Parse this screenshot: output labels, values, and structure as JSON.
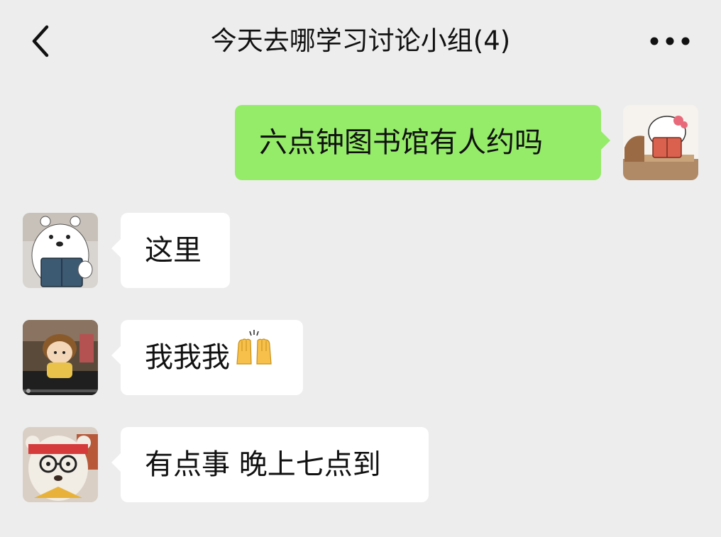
{
  "header": {
    "title": "今天去哪学习讨论小组(4)",
    "back_icon": "chevron-left-icon",
    "more_icon": "more-dots-icon"
  },
  "messages": [
    {
      "sender": "me",
      "avatar_icon": "hello-kitty-reading-avatar",
      "text": "六点钟图书馆有人约吗"
    },
    {
      "sender": "member",
      "avatar_icon": "white-bear-reading-avatar",
      "text": "这里"
    },
    {
      "sender": "member",
      "avatar_icon": "doll-avatar",
      "text": "我我我",
      "emoji": "raising-hands-emoji"
    },
    {
      "sender": "member",
      "avatar_icon": "teddy-bear-glasses-avatar",
      "text": "有点事 晚上七点到"
    }
  ],
  "colors": {
    "background": "#ededed",
    "outgoing_bubble": "#95ec69",
    "incoming_bubble": "#ffffff"
  }
}
